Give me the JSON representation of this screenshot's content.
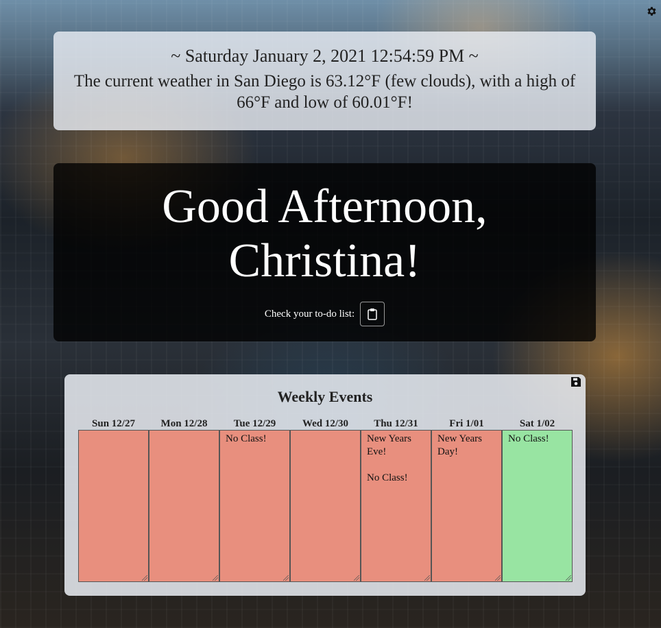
{
  "header": {
    "datetime": "~ Saturday January 2, 2021 12:54:59 PM ~",
    "weather": "The current weather in San Diego is 63.12°F (few clouds), with a high of 66°F and low of 60.01°F!"
  },
  "greeting": {
    "line1": "Good Afternoon,",
    "line2": "Christina!",
    "todo_label": "Check your to-do list:"
  },
  "events": {
    "title": "Weekly Events",
    "days": [
      {
        "label": "Sun 12/27",
        "text": "",
        "status": "past"
      },
      {
        "label": "Mon 12/28",
        "text": "",
        "status": "past"
      },
      {
        "label": "Tue 12/29",
        "text": "No Class!",
        "status": "past"
      },
      {
        "label": "Wed 12/30",
        "text": "",
        "status": "past"
      },
      {
        "label": "Thu 12/31",
        "text": "New Years Eve!\n\nNo Class!",
        "status": "past"
      },
      {
        "label": "Fri 1/01",
        "text": "New Years Day!",
        "status": "past"
      },
      {
        "label": "Sat 1/02",
        "text": "No Class!",
        "status": "today"
      }
    ]
  },
  "colors": {
    "past_day": "#e88f7e",
    "today": "#98e4a2"
  },
  "icons": {
    "settings": "gear-icon",
    "todo": "clipboard-icon",
    "save": "floppy-disk-icon"
  }
}
